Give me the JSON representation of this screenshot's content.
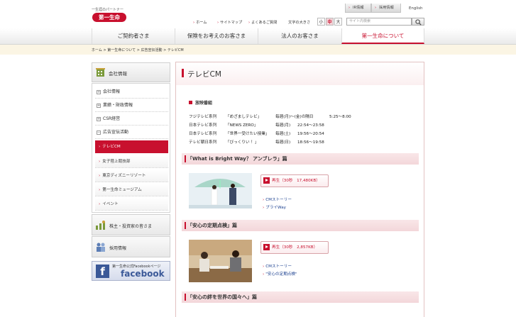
{
  "header": {
    "tagline": "一生涯のパートナー",
    "logo_text": "第一生命",
    "top_links": [
      {
        "label": "IR情報"
      },
      {
        "label": "採用情報"
      }
    ],
    "english": "English",
    "util_links": [
      {
        "label": "ホーム"
      },
      {
        "label": "サイトマップ"
      },
      {
        "label": "よくあるご質問"
      }
    ],
    "font_size_label": "文字の大きさ",
    "font_sizes": [
      "小",
      "中",
      "大"
    ],
    "search_placeholder": "サイト内検索"
  },
  "nav": [
    {
      "label": "ご契約者さま"
    },
    {
      "label": "保険をお考えのお客さま"
    },
    {
      "label": "法人のお客さま"
    },
    {
      "label": "第一生命について",
      "active": true
    }
  ],
  "breadcrumb": [
    "ホーム",
    "第一生命について",
    "広告宣伝活動",
    "テレビCM"
  ],
  "breadcrumb_sep": ">",
  "sidebar": {
    "heading": "会社情報",
    "items": [
      {
        "label": "会社情報"
      },
      {
        "label": "業績・財政情報"
      },
      {
        "label": "CSR経営"
      },
      {
        "label": "広告宣伝活動"
      }
    ],
    "sub_items": [
      {
        "label": "テレビCM",
        "active": true
      },
      {
        "label": "女子陸上競技部"
      },
      {
        "label": "東京ディズニーリゾート"
      },
      {
        "label": "第一生命ミュージアム"
      },
      {
        "label": "イベント"
      }
    ],
    "blocks": [
      {
        "label": "株主・投資家の皆さま"
      },
      {
        "label": "採用情報"
      }
    ],
    "facebook_caption": "第一生命公式Facebookページ",
    "facebook_word": "facebook",
    "facebook_letter": "f"
  },
  "main": {
    "title": "テレビCM",
    "schedule_heading": "放映番組",
    "schedule": [
      {
        "network": "フジテレビ系列",
        "program": "「めざましテレビ」",
        "when": "毎週(月)～(金)の隔日",
        "time": "5:25～8:00"
      },
      {
        "network": "日本テレビ系列",
        "program": "「NEWS ZERO」",
        "when": "毎週(月)",
        "time": "22:54～23:58"
      },
      {
        "network": "日本テレビ系列",
        "program": "「世界一受けたい授業」",
        "when": "毎週(土)",
        "time": "19:56～20:54"
      },
      {
        "network": "テレビ朝日系列",
        "program": "「びっくりい ！」",
        "when": "毎週(日)",
        "time": "18:56～19:58"
      }
    ],
    "sections": [
      {
        "title": "「What is Bright Way？ アンブレラ」篇",
        "play_label": "再生（30秒　17,480KB）",
        "links": [
          "CMストーリー",
          "ブライWay"
        ]
      },
      {
        "title": "「安心の定期点検」篇",
        "play_label": "再生（30秒　2,857KB）",
        "links": [
          "CMストーリー",
          "\"安心の定期点検\""
        ]
      },
      {
        "title": "「安心の絆を世界の国々へ」篇"
      }
    ]
  },
  "colors": {
    "brand_red": "#c8102e",
    "breadcrumb_band": "#fbf5e4",
    "facebook_blue": "#3b5998"
  }
}
